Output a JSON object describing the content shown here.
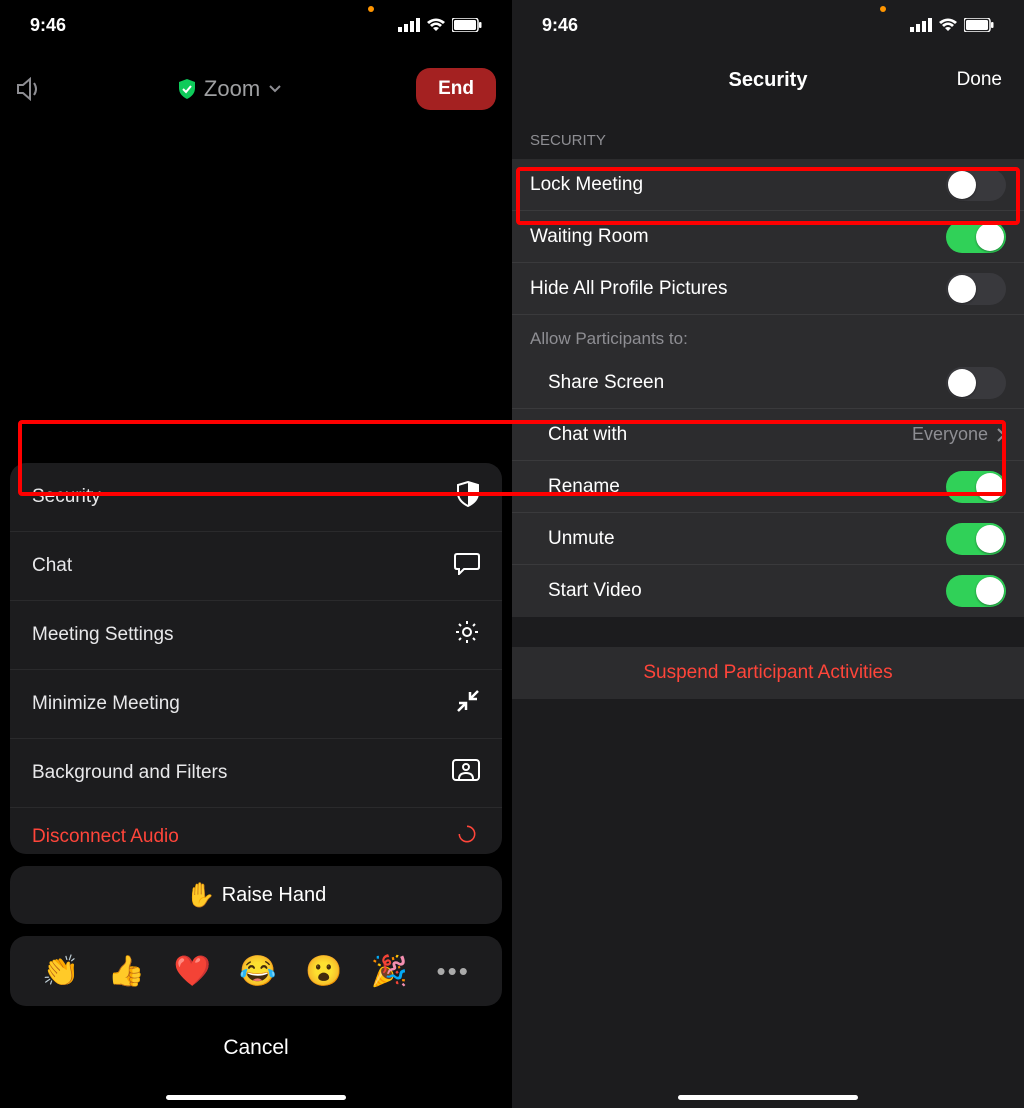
{
  "status": {
    "time": "9:46"
  },
  "left": {
    "title": "Zoom",
    "end_label": "End",
    "menu": {
      "security": "Security",
      "chat": "Chat",
      "meeting_settings": "Meeting Settings",
      "minimize": "Minimize Meeting",
      "background": "Background and Filters",
      "disconnect_audio": "Disconnect Audio"
    },
    "raise_hand": "Raise Hand",
    "reactions": {
      "clap": "👏",
      "thumbs": "👍",
      "heart": "❤️",
      "laugh": "😂",
      "wow": "😮",
      "party": "🎉"
    },
    "cancel": "Cancel"
  },
  "right": {
    "title": "Security",
    "done": "Done",
    "section_label": "SECURITY",
    "lock_meeting": {
      "label": "Lock Meeting",
      "on": false
    },
    "waiting_room": {
      "label": "Waiting Room",
      "on": true
    },
    "hide_pictures": {
      "label": "Hide All Profile Pictures",
      "on": false
    },
    "allow_label": "Allow Participants to:",
    "share_screen": {
      "label": "Share Screen",
      "on": false
    },
    "chat_with": {
      "label": "Chat with",
      "value": "Everyone"
    },
    "rename": {
      "label": "Rename",
      "on": true
    },
    "unmute": {
      "label": "Unmute",
      "on": true
    },
    "start_video": {
      "label": "Start Video",
      "on": true
    },
    "suspend": "Suspend Participant Activities"
  }
}
